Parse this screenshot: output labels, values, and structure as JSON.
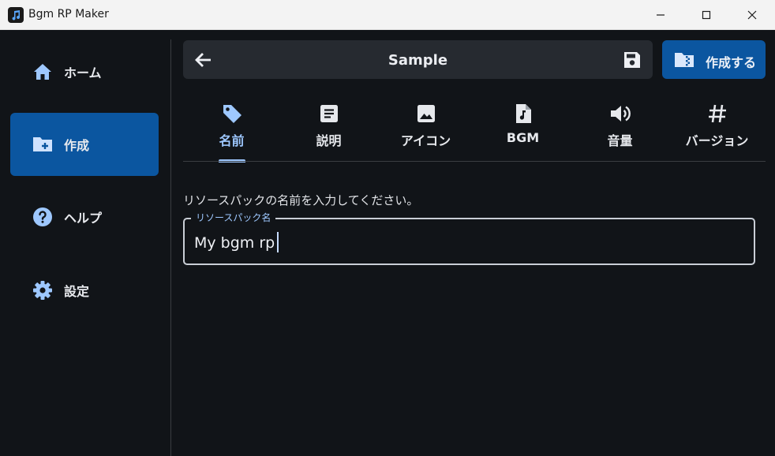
{
  "window": {
    "title": "Bgm RP Maker",
    "minimize_icon": "minimize-icon",
    "maximize_icon": "maximize-icon",
    "close_icon": "close-icon"
  },
  "sidebar": {
    "items": [
      {
        "label": "ホーム",
        "icon": "home-icon",
        "active": false
      },
      {
        "label": "作成",
        "icon": "create-folder-icon",
        "active": true
      },
      {
        "label": "ヘルプ",
        "icon": "help-icon",
        "active": false
      },
      {
        "label": "設定",
        "icon": "gear-icon",
        "active": false
      }
    ]
  },
  "header": {
    "title": "Sample",
    "back_icon": "arrow-back-icon",
    "save_icon": "save-icon"
  },
  "create_button": {
    "label": "作成する",
    "icon": "folder-zip-icon"
  },
  "tabs": [
    {
      "label": "名前",
      "icon": "tag-icon",
      "active": true
    },
    {
      "label": "説明",
      "icon": "description-icon",
      "active": false
    },
    {
      "label": "アイコン",
      "icon": "image-icon",
      "active": false
    },
    {
      "label": "BGM",
      "icon": "music-file-icon",
      "active": false
    },
    {
      "label": "音量",
      "icon": "volume-icon",
      "active": false
    },
    {
      "label": "バージョン",
      "icon": "hash-icon",
      "active": false
    }
  ],
  "content": {
    "prompt": "リソースパックの名前を入力してください。",
    "field_label": "リソースパック名",
    "field_value": "My bgm rp"
  },
  "colors": {
    "background": "#111418",
    "accent": "#0b56a0",
    "accent_light": "#9ec8ff",
    "surface": "#262a30",
    "titlebar": "#f3f3f3"
  }
}
